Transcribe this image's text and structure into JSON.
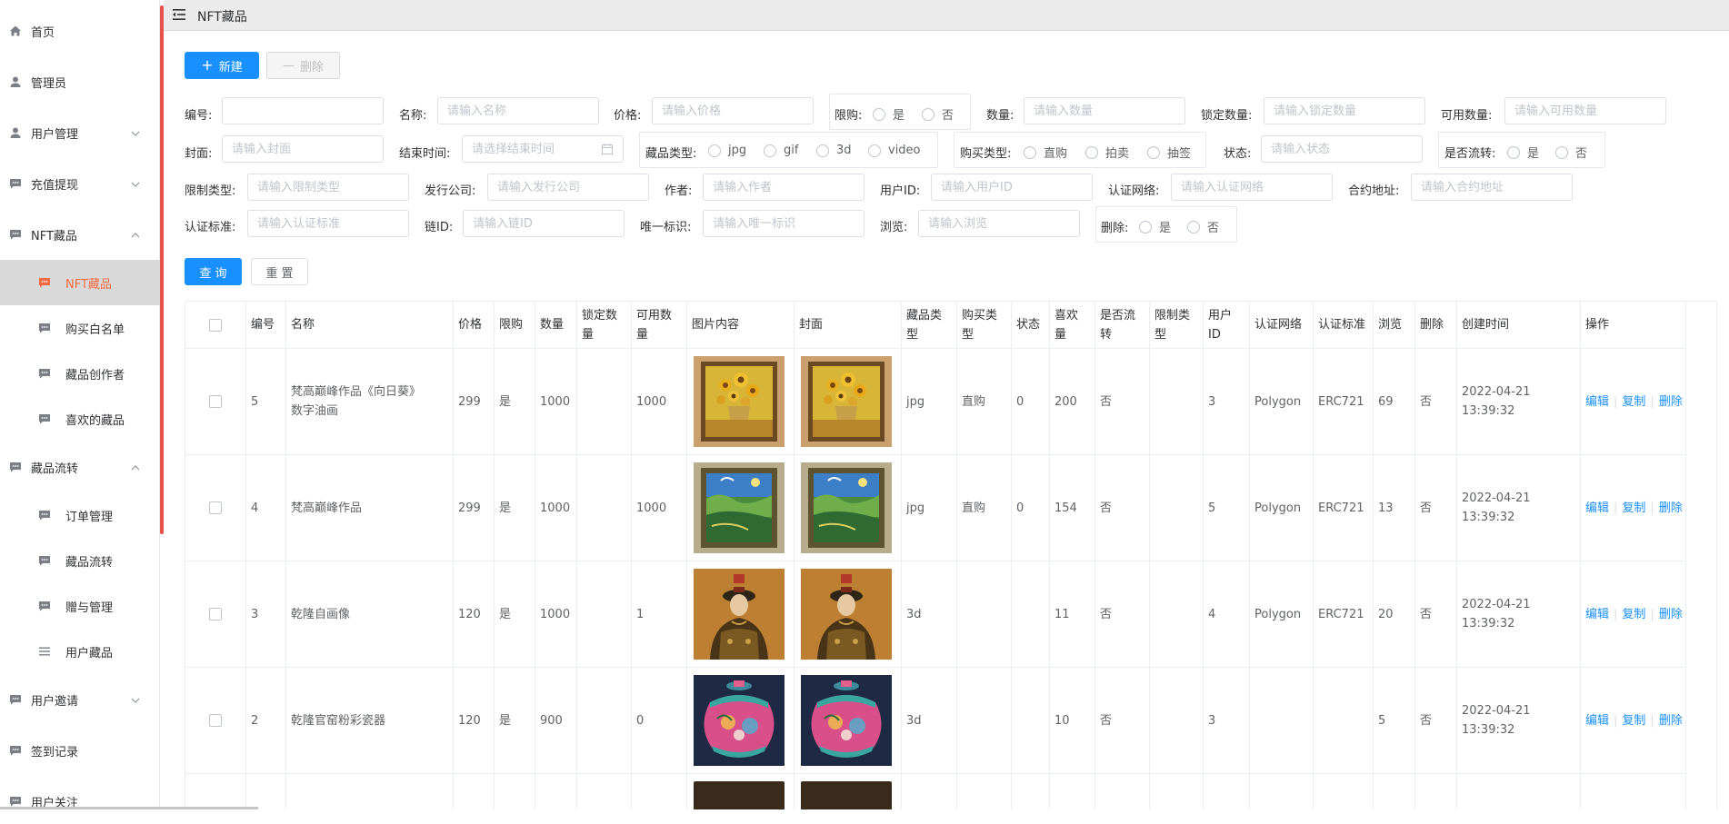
{
  "header": {
    "title": "NFT藏品"
  },
  "sidebar": {
    "items": [
      {
        "label": "首页",
        "icon": "home-icon"
      },
      {
        "label": "管理员",
        "icon": "user-icon"
      },
      {
        "label": "用户管理",
        "icon": "user-icon"
      },
      {
        "label": "充值提现",
        "icon": "chat-icon"
      },
      {
        "label": "NFT藏品",
        "icon": "chat-icon"
      },
      {
        "label": "藏品流转",
        "icon": "chat-icon"
      },
      {
        "label": "用户邀请",
        "icon": "chat-icon"
      },
      {
        "label": "签到记录",
        "icon": "chat-icon"
      },
      {
        "label": "用户关注",
        "icon": "chat-icon"
      }
    ],
    "nft_sub": [
      "NFT藏品",
      "购买白名单",
      "藏品创作者",
      "喜欢的藏品"
    ],
    "flow_sub": [
      "订单管理",
      "藏品流转",
      "赠与管理",
      "用户藏品"
    ]
  },
  "toolbar": {
    "new_label": "新建",
    "delete_label": "删除"
  },
  "form": {
    "id": {
      "label": "编号:",
      "placeholder": ""
    },
    "name": {
      "label": "名称:",
      "placeholder": "请输入名称"
    },
    "price": {
      "label": "价格:",
      "placeholder": "请输入价格"
    },
    "limit": {
      "label": "限购:",
      "yes": "是",
      "no": "否"
    },
    "qty": {
      "label": "数量:",
      "placeholder": "请输入数量"
    },
    "locked": {
      "label": "锁定数量:",
      "placeholder": "请输入锁定数量"
    },
    "avail": {
      "label": "可用数量:",
      "placeholder": "请输入可用数量"
    },
    "cover": {
      "label": "封面:",
      "placeholder": "请输入封面"
    },
    "end": {
      "label": "结束时间:",
      "placeholder": "请选择结束时间"
    },
    "ctype": {
      "label": "藏品类型:",
      "options": [
        "jpg",
        "gif",
        "3d",
        "video"
      ]
    },
    "btype": {
      "label": "购买类型:",
      "options": [
        "直购",
        "拍卖",
        "抽签"
      ]
    },
    "status": {
      "label": "状态:",
      "placeholder": "请输入状态"
    },
    "transfer": {
      "label": "是否流转:",
      "yes": "是",
      "no": "否"
    },
    "ltype": {
      "label": "限制类型:",
      "placeholder": "请输入限制类型"
    },
    "publisher": {
      "label": "发行公司:",
      "placeholder": "请输入发行公司"
    },
    "author": {
      "label": "作者:",
      "placeholder": "请输入作者"
    },
    "uid": {
      "label": "用户ID:",
      "placeholder": "请输入用户ID"
    },
    "network": {
      "label": "认证网络:",
      "placeholder": "请输入认证网络"
    },
    "contract": {
      "label": "合约地址:",
      "placeholder": "请输入合约地址"
    },
    "standard": {
      "label": "认证标准:",
      "placeholder": "请输入认证标准"
    },
    "chain": {
      "label": "链ID:",
      "placeholder": "请输入链ID"
    },
    "uniq": {
      "label": "唯一标识:",
      "placeholder": "请输入唯一标识"
    },
    "views": {
      "label": "浏览:",
      "placeholder": "请输入浏览"
    },
    "deleted": {
      "label": "删除:",
      "yes": "是",
      "no": "否"
    },
    "query_label": "查 询",
    "reset_label": "重 置"
  },
  "table": {
    "headers": [
      "编号",
      "名称",
      "价格",
      "限购",
      "数量",
      "锁定数量",
      "可用数量",
      "图片内容",
      "封面",
      "藏品类型",
      "购买类型",
      "状态",
      "喜欢量",
      "是否流转",
      "限制类型",
      "用户ID",
      "认证网络",
      "认证标准",
      "浏览",
      "删除",
      "创建时间",
      "操作"
    ],
    "header_lines": {
      "锁定数量": [
        "锁定数",
        "量"
      ],
      "可用数量": [
        "可用数",
        "量"
      ],
      "藏品类型": [
        "藏品类",
        "型"
      ],
      "购买类型": [
        "购买类",
        "型"
      ],
      "喜欢量": [
        "喜欢",
        "量"
      ],
      "是否流转": [
        "是否流",
        "转"
      ],
      "限制类型": [
        "限制类",
        "型"
      ],
      "用户ID": [
        "用户",
        "ID"
      ]
    },
    "ops": {
      "edit": "编辑",
      "copy": "复制",
      "del": "删除"
    },
    "rows": [
      {
        "id": "5",
        "name1": "梵高巅峰作品《向日葵》",
        "name2": "数字油画",
        "price": "299",
        "limit": "是",
        "qty": "1000",
        "locked": "",
        "avail": "1000",
        "type": "jpg",
        "buy": "直购",
        "status": "0",
        "likes": "200",
        "transfer": "否",
        "ltype": "",
        "uid": "3",
        "network": "Polygon",
        "standard": "ERC721",
        "views": "69",
        "deleted": "否",
        "date": "2022-04-21",
        "time": "13:39:32",
        "img": "sunflower"
      },
      {
        "id": "4",
        "name1": "梵高巅峰作品",
        "name2": "",
        "price": "299",
        "limit": "是",
        "qty": "1000",
        "locked": "",
        "avail": "1000",
        "type": "jpg",
        "buy": "直购",
        "status": "0",
        "likes": "154",
        "transfer": "否",
        "ltype": "",
        "uid": "5",
        "network": "Polygon",
        "standard": "ERC721",
        "views": "13",
        "deleted": "否",
        "date": "2022-04-21",
        "time": "13:39:32",
        "img": "landscape"
      },
      {
        "id": "3",
        "name1": "乾隆自画像",
        "name2": "",
        "price": "120",
        "limit": "是",
        "qty": "1000",
        "locked": "",
        "avail": "1",
        "type": "3d",
        "buy": "",
        "status": "",
        "likes": "11",
        "transfer": "否",
        "ltype": "",
        "uid": "4",
        "network": "Polygon",
        "standard": "ERC721",
        "views": "20",
        "deleted": "否",
        "date": "2022-04-21",
        "time": "13:39:32",
        "img": "portrait"
      },
      {
        "id": "2",
        "name1": "乾隆官窑粉彩瓷器",
        "name2": "",
        "price": "120",
        "limit": "是",
        "qty": "900",
        "locked": "",
        "avail": "0",
        "type": "3d",
        "buy": "",
        "status": "",
        "likes": "10",
        "transfer": "否",
        "ltype": "",
        "uid": "3",
        "network": "",
        "standard": "",
        "views": "5",
        "deleted": "否",
        "date": "2022-04-21",
        "time": "13:39:32",
        "img": "vase"
      }
    ]
  },
  "colors": {
    "primary": "#1890ff",
    "active_menu": "#f56c43",
    "scrollbar": "#e8504c"
  }
}
